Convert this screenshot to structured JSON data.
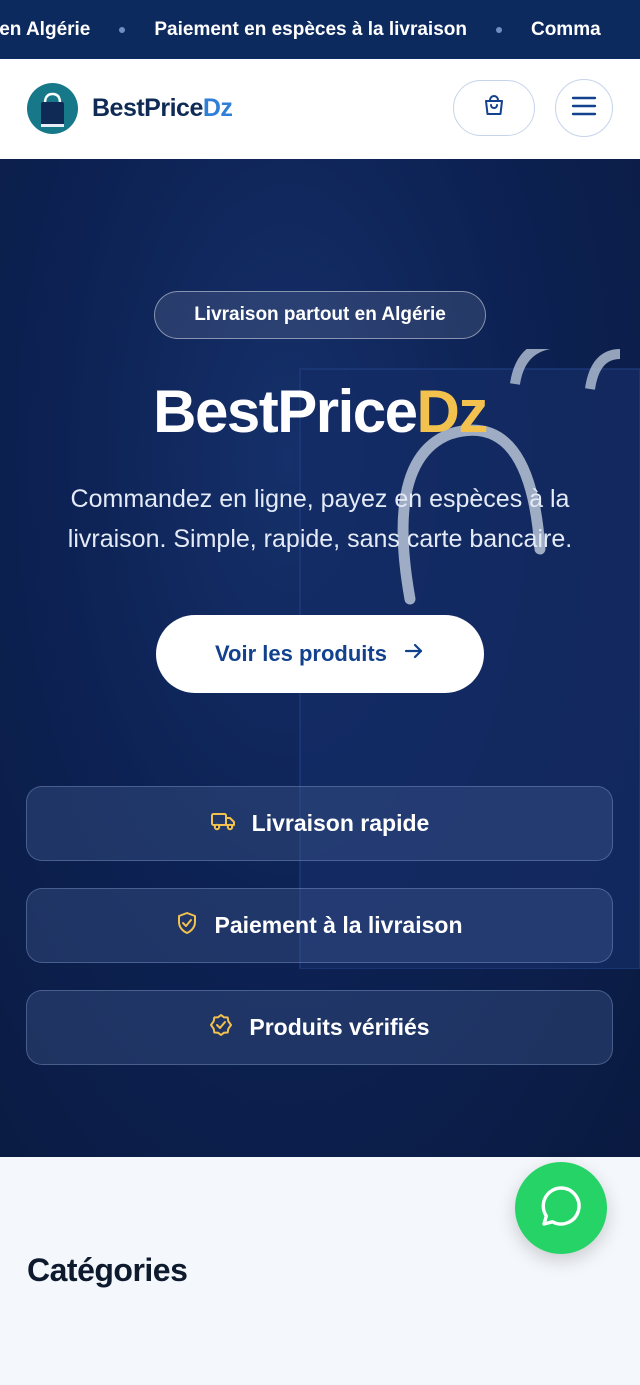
{
  "ticker": {
    "items": [
      "ut en Algérie",
      "Paiement en espèces à la livraison",
      "Comma"
    ]
  },
  "header": {
    "brand_main": "BestPrice",
    "brand_accent": "Dz",
    "cart_icon": "shopping-bag-icon",
    "menu_icon": "hamburger-menu-icon"
  },
  "hero": {
    "badge": "Livraison partout en Algérie",
    "title_main": "BestPrice",
    "title_accent": "Dz",
    "subtitle": "Commandez en ligne, payez en espèces à la livraison. Simple, rapide, sans carte bancaire.",
    "cta_label": "Voir les produits",
    "features": [
      {
        "label": "Livraison rapide",
        "icon": "truck-icon"
      },
      {
        "label": "Paiement à la livraison",
        "icon": "shield-check-icon"
      },
      {
        "label": "Produits vérifiés",
        "icon": "badge-check-icon"
      }
    ]
  },
  "categories": {
    "title": "Catégories"
  },
  "colors": {
    "navy": "#0c2a5e",
    "accent_blue": "#2f7fd8",
    "accent_yellow": "#f2c14e",
    "whatsapp_green": "#25d366"
  }
}
